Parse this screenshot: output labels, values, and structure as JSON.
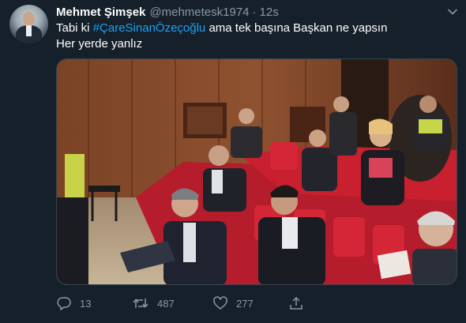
{
  "tweet": {
    "author_name": "Mehmet Şimşek",
    "author_handle": "@mehmetesk1974",
    "separator": "·",
    "time": "12s",
    "text_prefix": "Tabi ki ",
    "hashtag": "#ÇareSinanÖzeçoğlu",
    "text_suffix": " ama tek başına Başkan ne yapsın",
    "text_line2": "Her yerde yanlız"
  },
  "icons": {
    "avatar": "profile-photo",
    "more": "chevron-down-icon",
    "reply": "reply-icon",
    "retweet": "retweet-icon",
    "like": "heart-icon",
    "share": "share-icon"
  },
  "actions": {
    "reply_count": "13",
    "retweet_count": "487",
    "like_count": "277"
  },
  "colors": {
    "background": "#15202b",
    "text": "#ffffff",
    "secondary_text": "#8899a6",
    "hashtag": "#1da1f2"
  }
}
